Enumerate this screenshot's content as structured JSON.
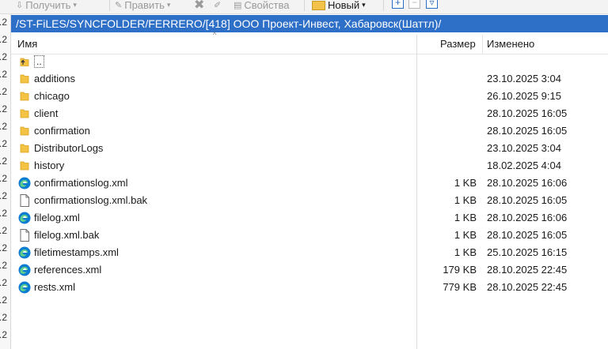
{
  "toolbar": {
    "get": "Получить",
    "edit": "Править",
    "properties": "Свойства",
    "new": "Новый"
  },
  "path": "/ST-FiLES/SYNCFOLDER/FERRERO/[418] ООО Проект-Инвест, Хабаровск(Шаттл)/",
  "columns": {
    "name": "Имя",
    "size": "Размер",
    "modified": "Изменено"
  },
  "rows": [
    {
      "name": "..",
      "size": "",
      "modified": "",
      "icon": "up-folder-icon"
    },
    {
      "name": "additions",
      "size": "",
      "modified": "23.10.2025 3:04",
      "icon": "folder-icon"
    },
    {
      "name": "chicago",
      "size": "",
      "modified": "26.10.2025 9:15",
      "icon": "folder-icon"
    },
    {
      "name": "client",
      "size": "",
      "modified": "28.10.2025 16:05",
      "icon": "folder-icon"
    },
    {
      "name": "confirmation",
      "size": "",
      "modified": "28.10.2025 16:05",
      "icon": "folder-icon"
    },
    {
      "name": "DistributorLogs",
      "size": "",
      "modified": "23.10.2025 3:04",
      "icon": "folder-icon"
    },
    {
      "name": "history",
      "size": "",
      "modified": "18.02.2025 4:04",
      "icon": "folder-icon"
    },
    {
      "name": "confirmationslog.xml",
      "size": "1 KB",
      "modified": "28.10.2025 16:06",
      "icon": "edge-icon"
    },
    {
      "name": "confirmationslog.xml.bak",
      "size": "1 KB",
      "modified": "28.10.2025 16:05",
      "icon": "file-icon"
    },
    {
      "name": "filelog.xml",
      "size": "1 KB",
      "modified": "28.10.2025 16:06",
      "icon": "edge-icon"
    },
    {
      "name": "filelog.xml.bak",
      "size": "1 KB",
      "modified": "28.10.2025 16:05",
      "icon": "file-icon"
    },
    {
      "name": "filetimestamps.xml",
      "size": "1 KB",
      "modified": "25.10.2025 16:15",
      "icon": "edge-icon"
    },
    {
      "name": "references.xml",
      "size": "179 KB",
      "modified": "28.10.2025 22:45",
      "icon": "edge-icon"
    },
    {
      "name": "rests.xml",
      "size": "779 KB",
      "modified": "28.10.2025 22:45",
      "icon": "edge-icon"
    }
  ]
}
